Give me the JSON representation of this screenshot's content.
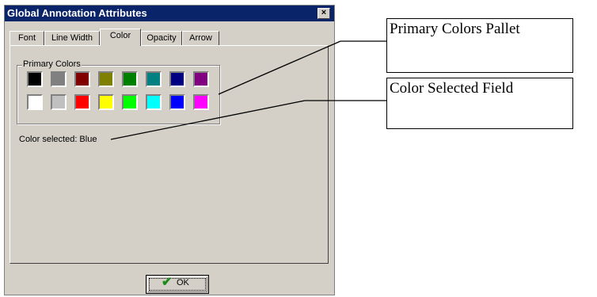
{
  "dialog": {
    "title": "Global Annotation Attributes",
    "close_symbol": "×",
    "tabs": [
      {
        "label": "Font"
      },
      {
        "label": "Line Width"
      },
      {
        "label": "Color"
      },
      {
        "label": "Opacity"
      },
      {
        "label": "Arrow"
      }
    ],
    "active_tab": "Color",
    "primary_colors": {
      "label": "Primary Colors",
      "swatches": [
        "#000000",
        "#808080",
        "#800000",
        "#808000",
        "#008000",
        "#008080",
        "#000080",
        "#800080",
        "#ffffff",
        "#c0c0c0",
        "#ff0000",
        "#ffff00",
        "#00ff00",
        "#00ffff",
        "#0000ff",
        "#ff00ff"
      ]
    },
    "color_selected_text": "Color selected: Blue",
    "ok_button": {
      "label": "OK",
      "icon": "checkmark-icon"
    }
  },
  "callouts": [
    {
      "text": "Primary Colors Pallet"
    },
    {
      "text": "Color Selected Field"
    }
  ],
  "colors": {
    "titlebar": "#0a246a",
    "dialog_bg": "#d4d0c8",
    "check": "#1a8a1a"
  }
}
